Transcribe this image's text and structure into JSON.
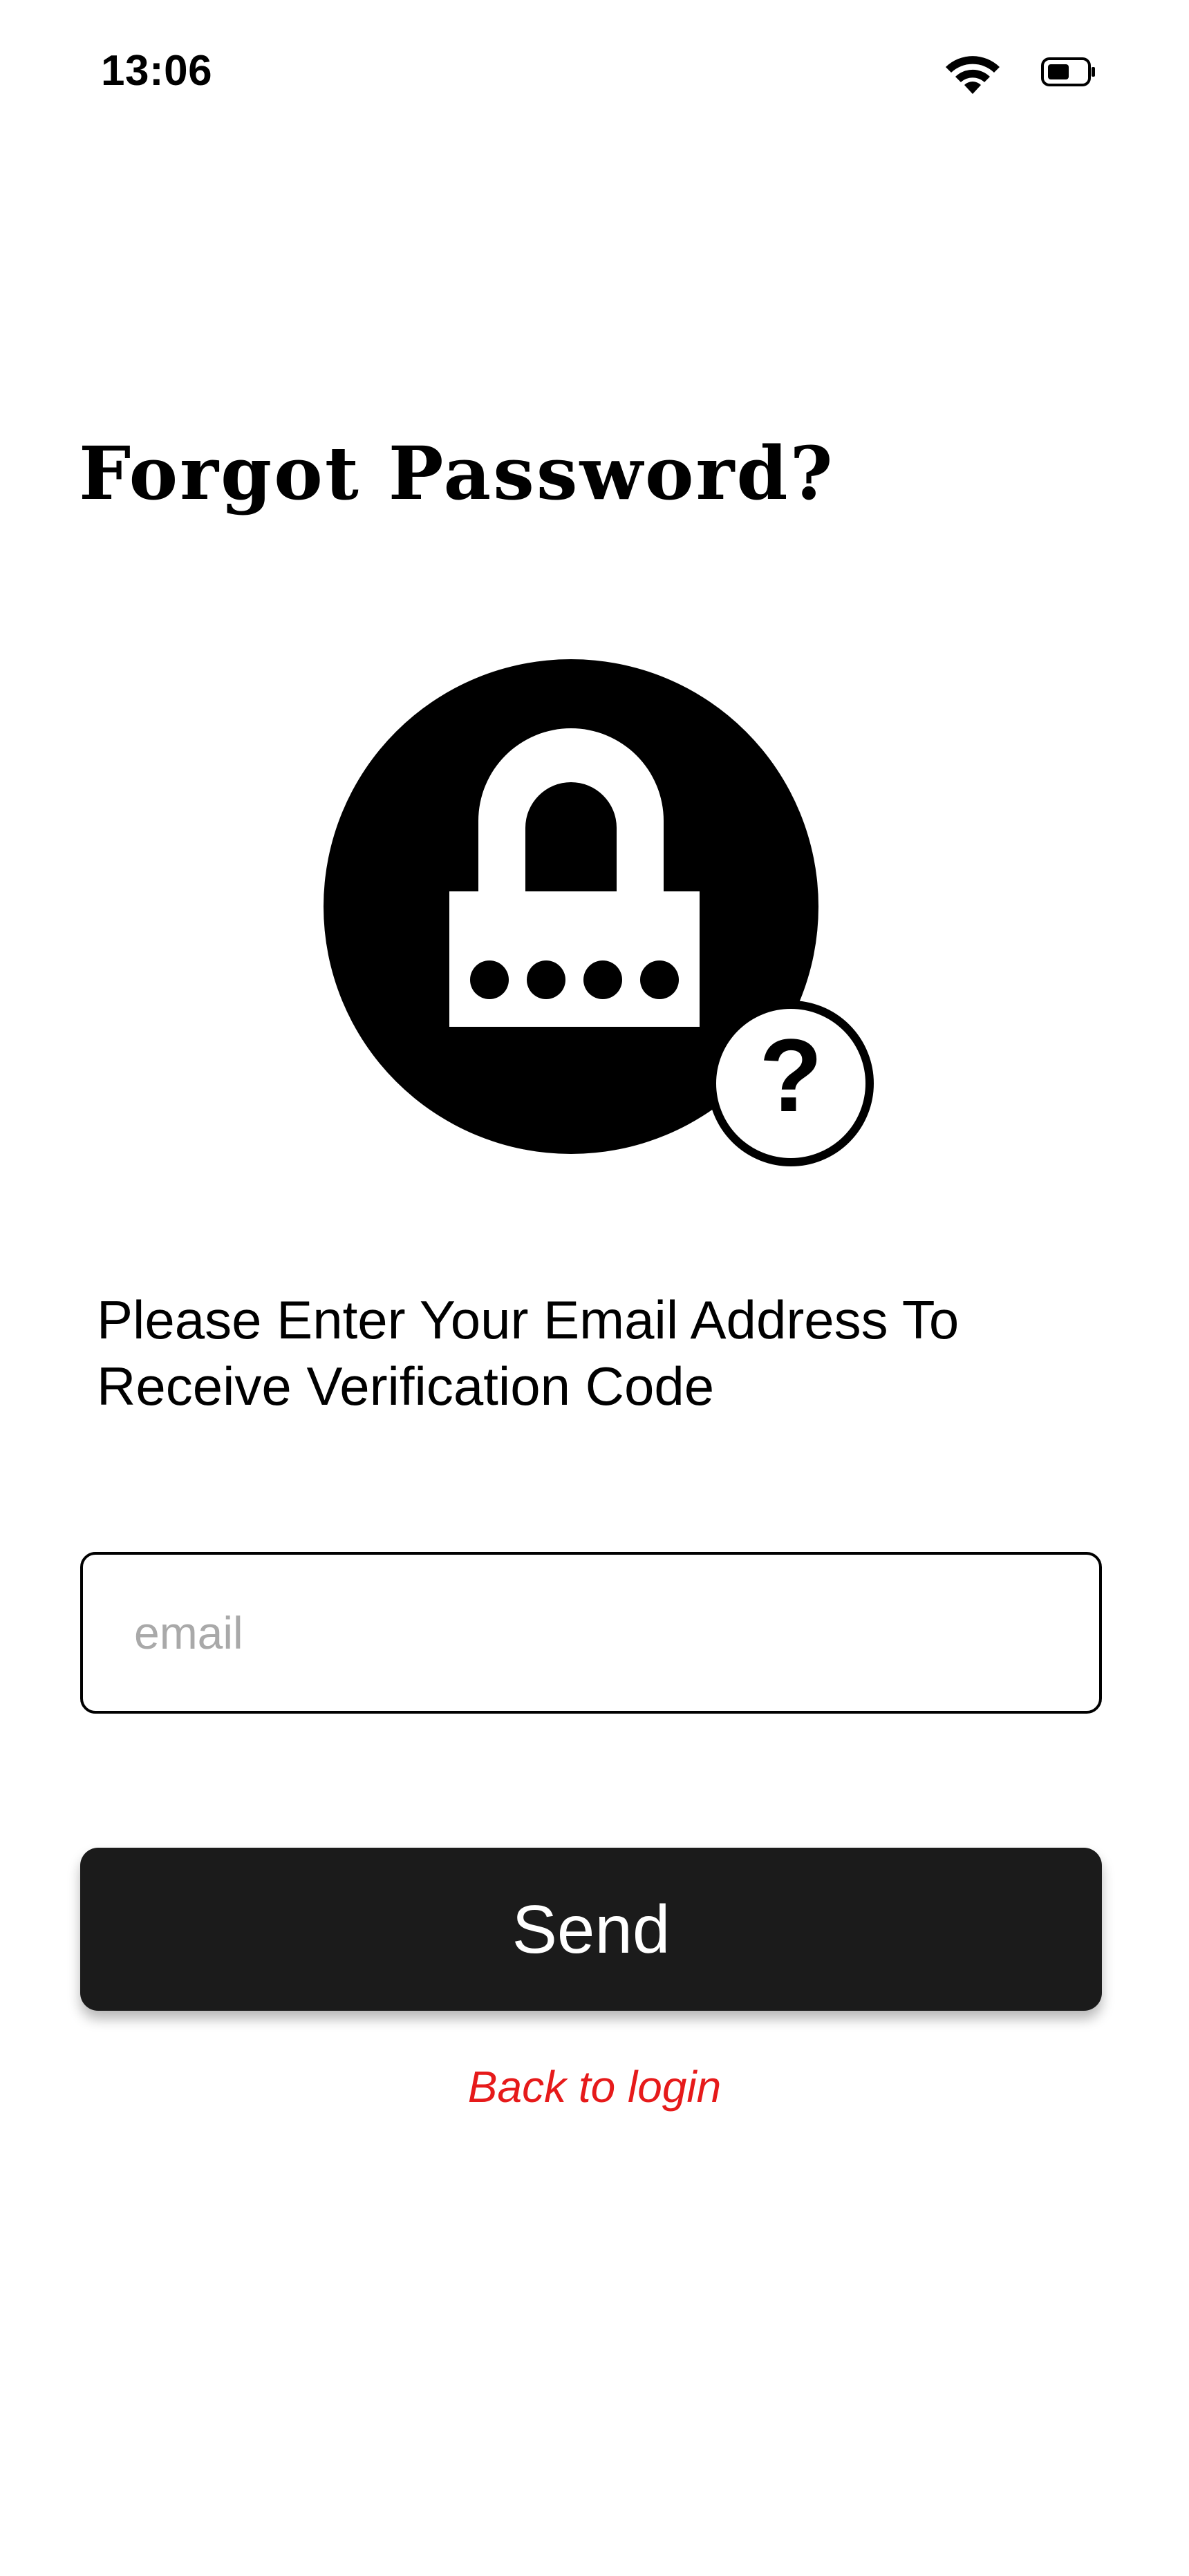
{
  "status_bar": {
    "time": "13:06",
    "wifi_icon": "wifi-icon",
    "battery_icon": "battery-icon"
  },
  "header": {
    "title": "Forgot Password?"
  },
  "hero": {
    "icon": "lock-question-icon"
  },
  "form": {
    "instruction": "Please Enter Your Email Address To Receive Verification Code",
    "email_value": "",
    "email_placeholder": "email",
    "send_label": "Send",
    "back_label": "Back to login"
  },
  "colors": {
    "button_bg": "#1b1b1b",
    "link": "#e61a1a",
    "placeholder": "#a9a9a9"
  }
}
